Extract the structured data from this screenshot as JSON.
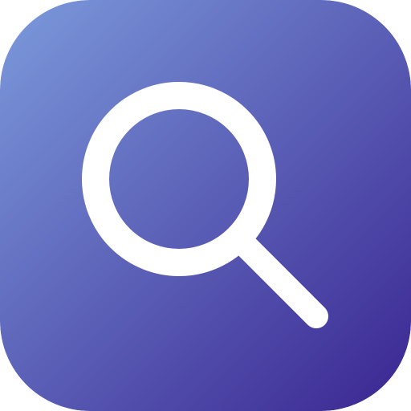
{
  "app_icon": {
    "icon": "search-icon",
    "gradient_start": "#7C9ADC",
    "gradient_end": "#3A2591",
    "glyph_color": "#FFFFFF"
  }
}
